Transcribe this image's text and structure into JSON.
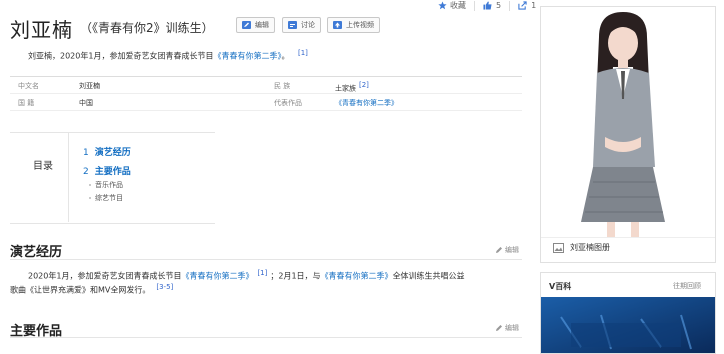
{
  "top_stats": {
    "favorite_label": "收藏",
    "like_count": "5",
    "share_count": "1"
  },
  "header": {
    "title": "刘亚楠",
    "subtitle": "（《青春有你2》训练生）",
    "buttons": {
      "edit": "编辑",
      "discuss": "讨论",
      "upload_video": "上传视频"
    }
  },
  "summary": {
    "text_prefix": "刘亚楠，2020年1月，参加爱奇艺女团青春成长节目",
    "link": "《青春有你第二季》",
    "text_suffix": "。",
    "ref": "[1]"
  },
  "infobox": {
    "rows": [
      {
        "k1": "中文名",
        "v1": "刘亚楠",
        "k2": "民    族",
        "v2": "土家族",
        "v2_ref": "[2]"
      },
      {
        "k1": "国    籍",
        "v1": "中国",
        "k2": "代表作品",
        "v2": "《青春有你第二季》",
        "v2_ref": ""
      }
    ]
  },
  "toc": {
    "title": "目录",
    "items": [
      {
        "num": "1",
        "label": "演艺经历"
      },
      {
        "num": "2",
        "label": "主要作品"
      }
    ],
    "subitems": [
      "音乐作品",
      "综艺节目"
    ]
  },
  "sections": [
    {
      "heading": "演艺经历",
      "edit": "编辑",
      "p1_a": "2020年1月，参加爱奇艺女团青春成长节目",
      "p1_link1": "《青春有你第二季》",
      "p1_ref1": "[1]",
      "p1_b": "；2月1日，与",
      "p1_link2": "《青春有你第二季》",
      "p1_c": "全体训练生共唱公益",
      "p2_a": "歌曲《让世界充满爱》和MV全网发行。",
      "p2_ref": "[3-5]"
    },
    {
      "heading": "主要作品",
      "edit": "编辑"
    }
  ],
  "sidebar": {
    "gallery_label": "刘亚楠图册",
    "vbaike_title": "V百科",
    "vbaike_more": "往期回顾"
  },
  "colors": {
    "link": "#136ec2",
    "ref": "#3366cc",
    "button_icon": "#3f7ad6"
  }
}
